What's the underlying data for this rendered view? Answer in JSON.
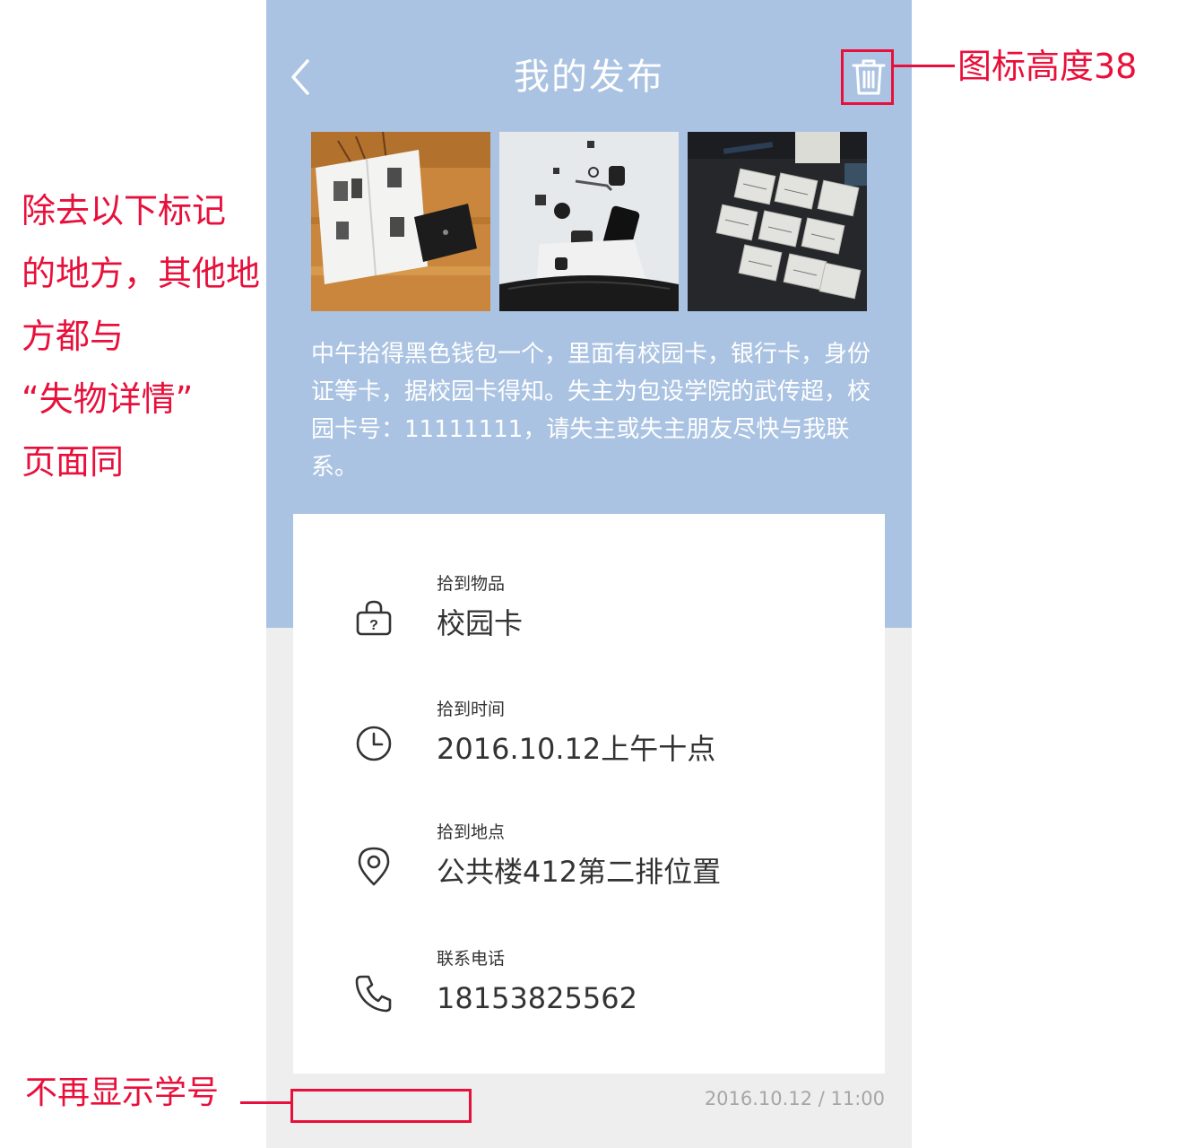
{
  "header": {
    "title": "我的发布",
    "back_icon": "chevron-left-icon",
    "delete_icon": "trash-icon"
  },
  "photos": [
    {
      "name": "open-book-wallet-photo"
    },
    {
      "name": "keys-phone-bag-photo"
    },
    {
      "name": "paper-sketches-photo"
    }
  ],
  "description": "中午拾得黑色钱包一个，里面有校园卡，银行卡，身份证等卡，据校园卡得知。失主为包设学院的武传超，校园卡号：11111111，请失主或失主朋友尽快与我联系。",
  "details": [
    {
      "icon": "lock-question-icon",
      "label": "拾到物品",
      "value": "校园卡"
    },
    {
      "icon": "clock-icon",
      "label": "拾到时间",
      "value": "2016.10.12上午十点"
    },
    {
      "icon": "location-pin-icon",
      "label": "拾到地点",
      "value": "公共楼412第二排位置"
    },
    {
      "icon": "phone-icon",
      "label": "联系电话",
      "value": "18153825562"
    }
  ],
  "timestamp": "2016.10.12 / 11:00",
  "annotations": {
    "left_note_lines": [
      "除去以下标记",
      "的地方，其他地",
      "方都与",
      "“失物详情”",
      "页面同"
    ],
    "icon_height_note": "图标高度38",
    "student_id_note": "不再显示学号"
  },
  "colors": {
    "hero_background": "#abc3e2",
    "page_background": "#eeeeee",
    "card_background": "#ffffff",
    "annotation": "#e8103b",
    "timestamp": "#a6a6a6"
  }
}
